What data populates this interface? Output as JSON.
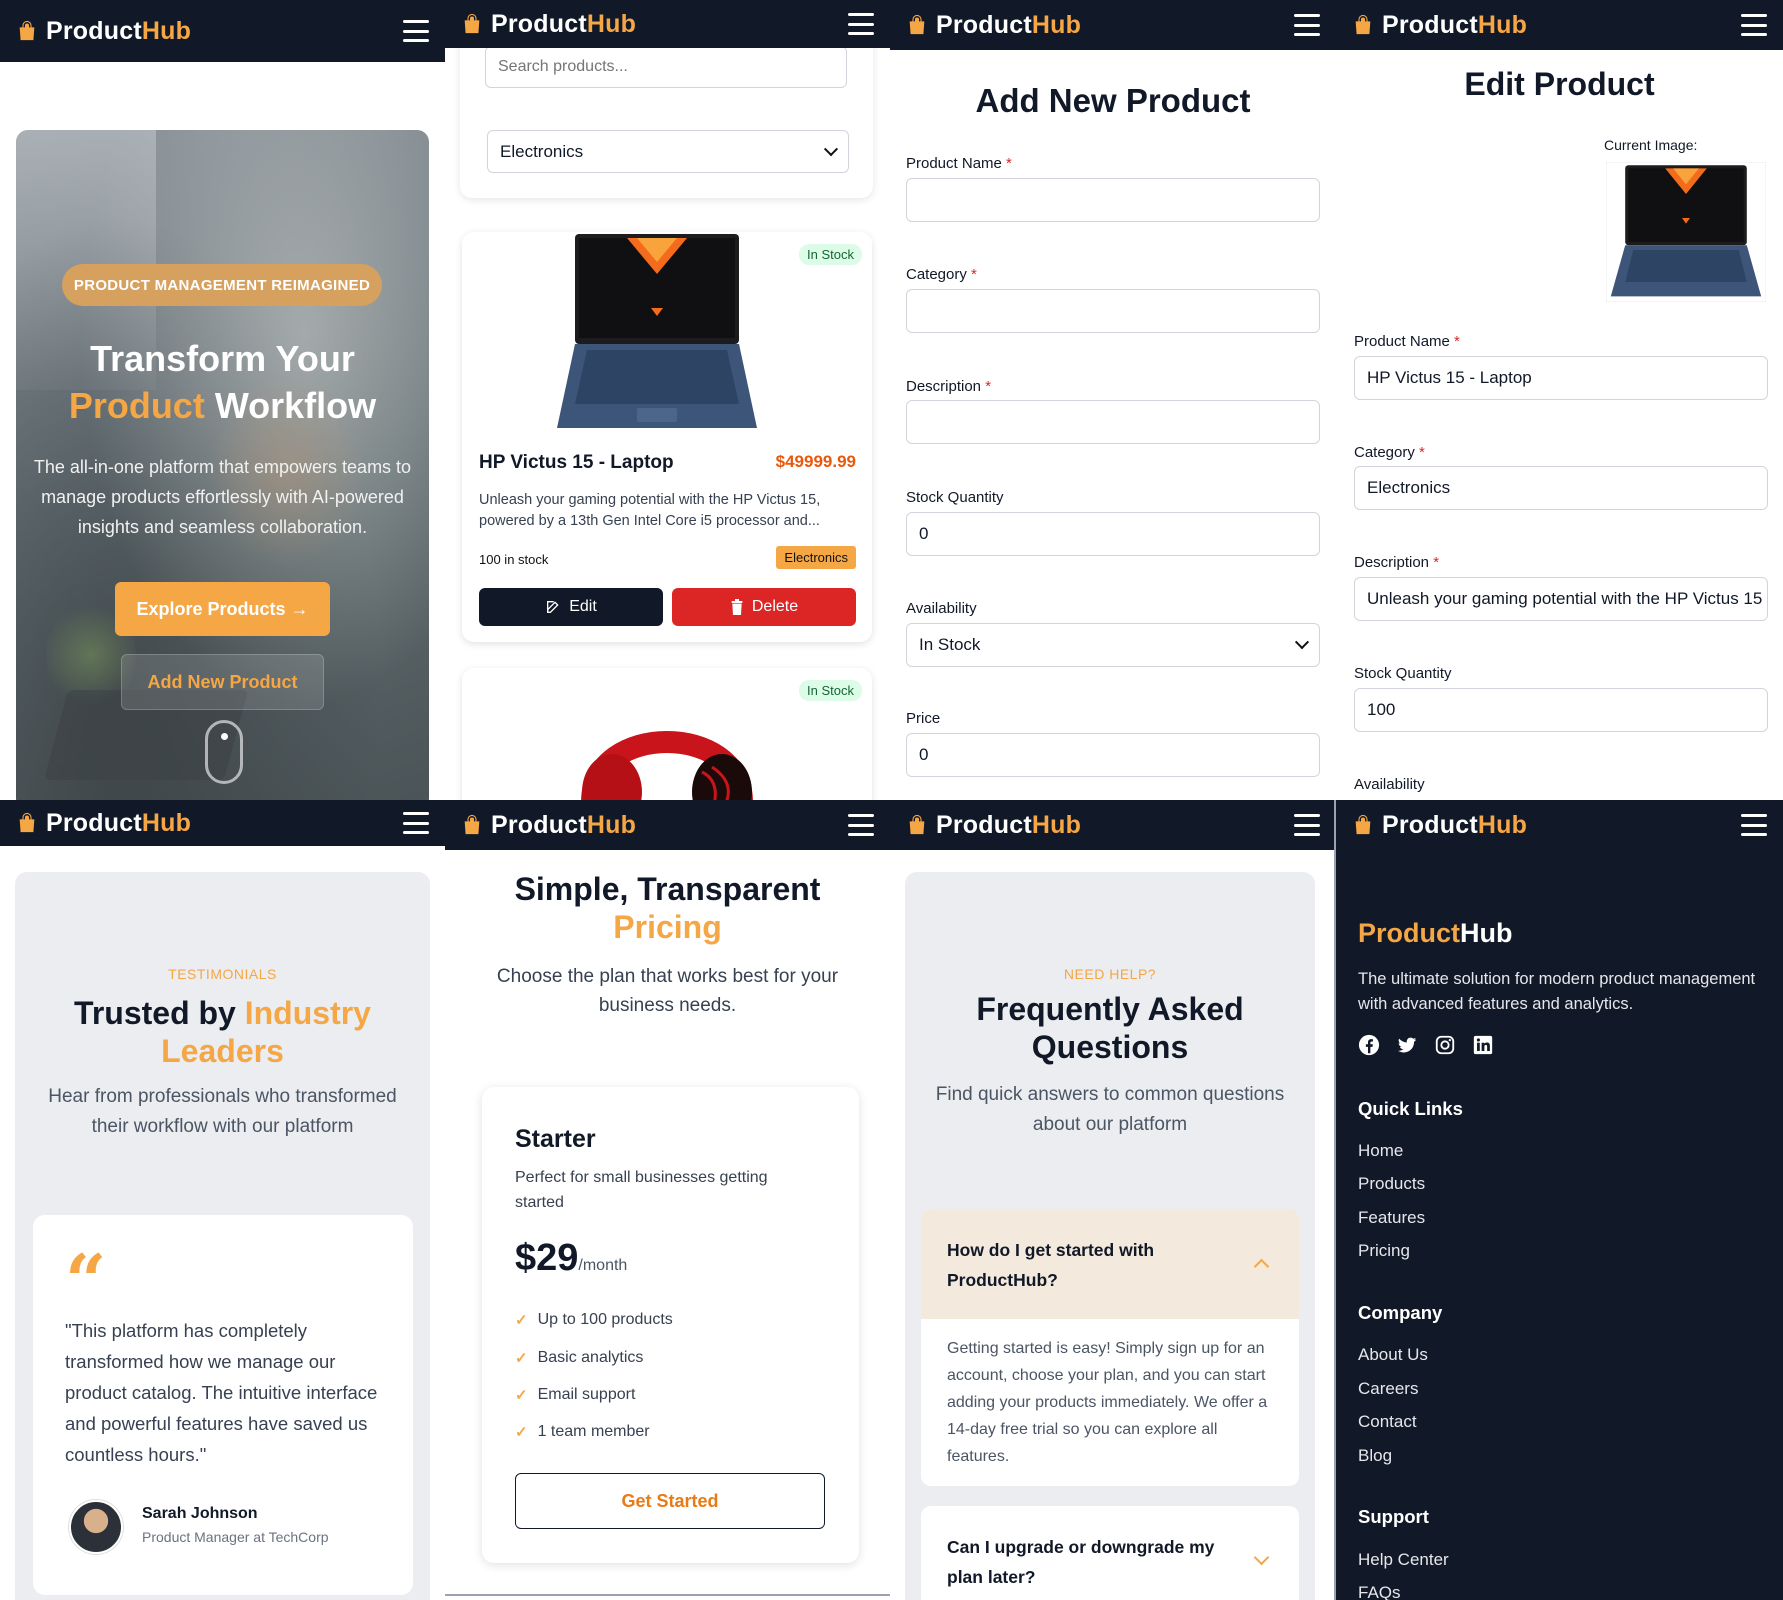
{
  "brand": {
    "prefix": "Product",
    "suffix": "Hub"
  },
  "hero": {
    "badge": "PRODUCT MANAGEMENT REIMAGINED",
    "title_line1": "Transform Your",
    "title_accent": "Product",
    "title_rest": " Workflow",
    "description": "The all-in-one platform that empowers teams to manage products effortlessly with AI-powered insights and seamless collaboration.",
    "explore_label": "Explore Products →",
    "add_label": "Add New Product"
  },
  "catalog": {
    "search_placeholder": "Search products...",
    "category_value": "Electronics",
    "products": [
      {
        "name": "HP Victus 15 - Laptop",
        "price": "$49999.99",
        "stock_badge": "In Stock",
        "description": "Unleash your gaming potential with the HP Victus 15, powered by a 13th Gen Intel Core i5 processor and...",
        "quantity": "100 in stock",
        "category": "Electronics",
        "edit_label": "Edit",
        "delete_label": "Delete"
      },
      {
        "stock_badge": "In Stock"
      }
    ]
  },
  "add_form": {
    "title": "Add New Product",
    "fields": {
      "name": {
        "label": "Product Name",
        "required": "*",
        "value": ""
      },
      "category": {
        "label": "Category",
        "required": "*",
        "value": ""
      },
      "description": {
        "label": "Description",
        "required": "*",
        "value": ""
      },
      "stock": {
        "label": "Stock Quantity",
        "value": "0"
      },
      "availability": {
        "label": "Availability",
        "value": "In Stock"
      },
      "price": {
        "label": "Price",
        "value": "0"
      }
    }
  },
  "edit_form": {
    "title": "Edit Product",
    "current_image_label": "Current Image:",
    "fields": {
      "name": {
        "label": "Product Name",
        "required": "*",
        "value": "HP Victus 15 - Laptop"
      },
      "category": {
        "label": "Category",
        "required": "*",
        "value": "Electronics"
      },
      "description": {
        "label": "Description",
        "required": "*",
        "value": "Unleash your gaming potential with the HP Victus 15"
      },
      "stock": {
        "label": "Stock Quantity",
        "value": "100"
      },
      "availability": {
        "label": "Availability"
      }
    }
  },
  "testimonials": {
    "eyebrow": "TESTIMONIALS",
    "title_plain": "Trusted by ",
    "title_accent": "Industry Leaders",
    "subtitle": "Hear from professionals who transformed their workflow with our platform",
    "quote_mark": "“",
    "quote": "\"This platform has completely transformed how we manage our product catalog. The intuitive interface and powerful features have saved us countless hours.\"",
    "author": "Sarah Johnson",
    "role": "Product Manager at TechCorp"
  },
  "pricing": {
    "title_plain": "Simple, Transparent",
    "title_accent": "Pricing",
    "subtitle": "Choose the plan that works best for your business needs.",
    "plan": {
      "name": "Starter",
      "description": "Perfect for small businesses getting started",
      "price": "$29",
      "period": "/month",
      "features": [
        "Up to 100 products",
        "Basic analytics",
        "Email support",
        "1 team member"
      ],
      "cta": "Get Started"
    }
  },
  "faq": {
    "eyebrow": "NEED HELP?",
    "title": "Frequently Asked Questions",
    "subtitle": "Find quick answers to common questions about our platform",
    "items": [
      {
        "question": "How do I get started with ProductHub?",
        "answer": "Getting started is easy! Simply sign up for an account, choose your plan, and you can start adding your products immediately. We offer a 14-day free trial so you can explore all features.",
        "expanded": true
      },
      {
        "question": "Can I upgrade or downgrade my plan later?",
        "expanded": false
      }
    ]
  },
  "footer": {
    "brand_prefix": "Product",
    "brand_suffix": "Hub",
    "description": "The ultimate solution for modern product management with advanced features and analytics.",
    "social": [
      "facebook-icon",
      "twitter-icon",
      "instagram-icon",
      "linkedin-icon"
    ],
    "quick_links_title": "Quick Links",
    "quick_links": [
      "Home",
      "Products",
      "Features",
      "Pricing"
    ],
    "company_title": "Company",
    "company_links": [
      "About Us",
      "Careers",
      "Contact",
      "Blog"
    ],
    "support_title": "Support",
    "support_links": [
      "Help Center",
      "FAQs"
    ]
  },
  "colors": {
    "accent": "#f5a645",
    "dark": "#111827",
    "danger": "#dc2626",
    "price": "#ea580c"
  }
}
